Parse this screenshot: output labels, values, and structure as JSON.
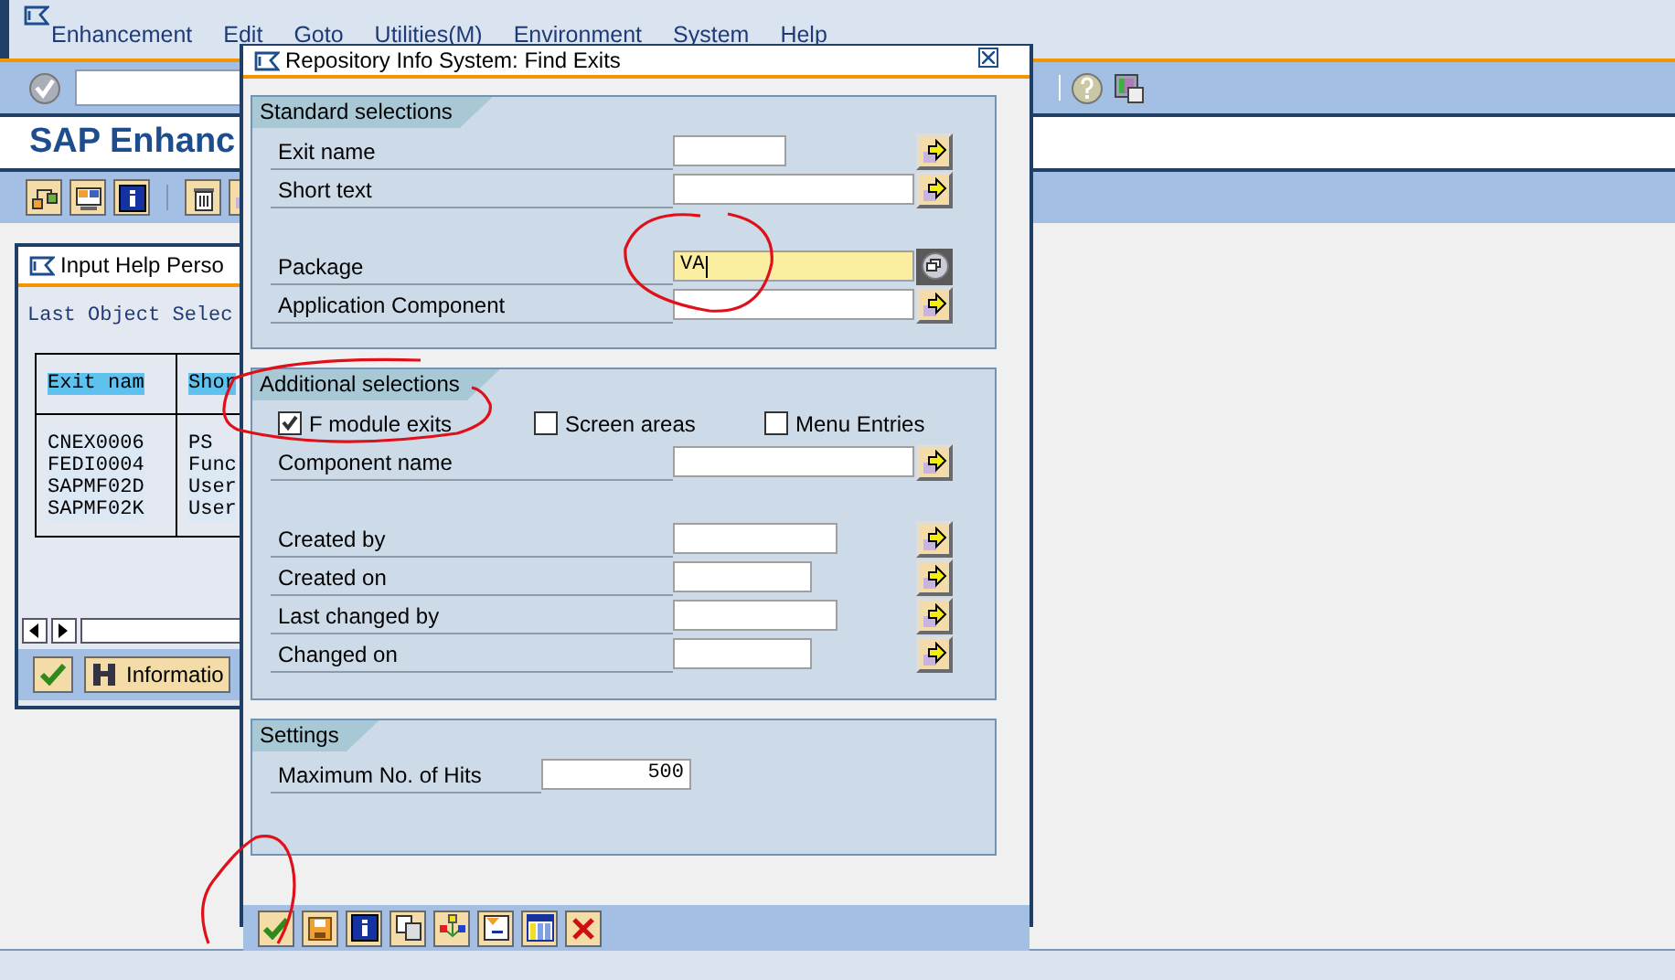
{
  "main_window": {
    "menu": [
      {
        "label": "Enhancement"
      },
      {
        "label": "Edit"
      },
      {
        "label": "Goto"
      },
      {
        "label": "Utilities(M)"
      },
      {
        "label": "Environment"
      },
      {
        "label": "System"
      },
      {
        "label": "Help"
      }
    ],
    "title": "SAP Enhanc"
  },
  "input_help": {
    "title": "Input Help Perso",
    "heading": "Last Object Selec",
    "columns": [
      "Exit nam",
      "Shor"
    ],
    "rows": [
      [
        "CNEX0006",
        "PS"
      ],
      [
        "FEDI0004",
        "Func"
      ],
      [
        "SAPMF02D",
        "User"
      ],
      [
        "SAPMF02K",
        "User"
      ]
    ],
    "info_button": "Informatio"
  },
  "dialog": {
    "title": "Repository Info System: Find Exits",
    "groups": [
      {
        "title": "Standard selections",
        "rows": [
          {
            "kind": "field",
            "label": "Exit name",
            "input": {
              "kind": "short"
            },
            "button": {
              "kind": "arrow"
            }
          },
          {
            "kind": "field",
            "label": "Short text",
            "input": {
              "kind": "long"
            },
            "button": {
              "kind": "arrow"
            }
          },
          {
            "kind": "field",
            "label": "Package",
            "input": {
              "kind": "long",
              "value": "VA",
              "focused": true
            },
            "button": {
              "kind": "popup"
            },
            "gap_before": true
          },
          {
            "kind": "field",
            "label": "Application Component",
            "input": {
              "kind": "long"
            },
            "button": {
              "kind": "arrow"
            }
          }
        ]
      },
      {
        "title": "Additional selections",
        "rows": [
          {
            "kind": "checkboxes",
            "items": [
              {
                "label": "F module exits",
                "checked": true
              },
              {
                "label": "Screen areas",
                "checked": false
              },
              {
                "label": "Menu Entries",
                "checked": false
              }
            ]
          },
          {
            "kind": "field",
            "label": "Component name",
            "input": {
              "kind": "long"
            },
            "button": {
              "kind": "arrow"
            }
          },
          {
            "kind": "field",
            "label": "Created by",
            "input": {
              "kind": "medium"
            },
            "button": {
              "kind": "arrow"
            },
            "gap_before": true
          },
          {
            "kind": "field",
            "label": "Created on",
            "input": {
              "kind": "small"
            },
            "button": {
              "kind": "arrow"
            }
          },
          {
            "kind": "field",
            "label": "Last changed by",
            "input": {
              "kind": "medium"
            },
            "button": {
              "kind": "arrow"
            }
          },
          {
            "kind": "field",
            "label": "Changed on",
            "input": {
              "kind": "small"
            },
            "button": {
              "kind": "arrow"
            }
          }
        ]
      },
      {
        "title": "Settings",
        "rows": [
          {
            "kind": "number",
            "label": "Maximum No. of Hits",
            "value": "500"
          }
        ]
      }
    ],
    "toolbar": [
      {
        "kind": "check"
      },
      {
        "kind": "save"
      },
      {
        "kind": "info"
      },
      {
        "kind": "copy"
      },
      {
        "kind": "tree"
      },
      {
        "kind": "document"
      },
      {
        "kind": "columns"
      },
      {
        "kind": "cancel"
      }
    ]
  }
}
